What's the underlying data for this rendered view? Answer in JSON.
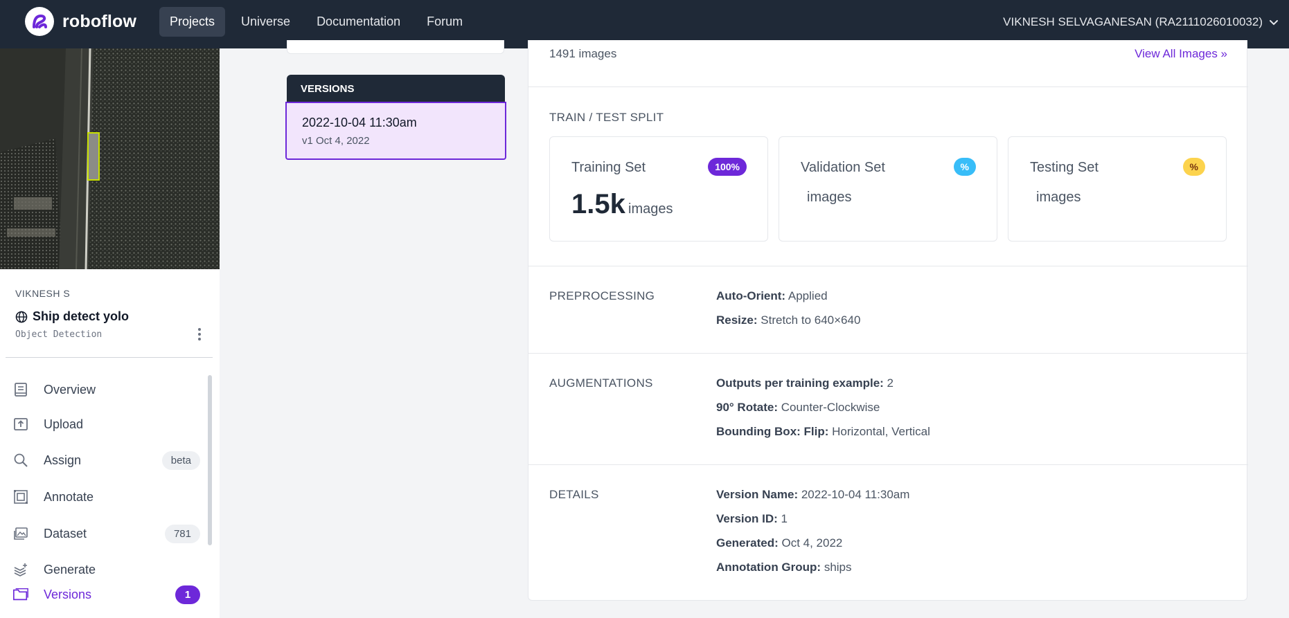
{
  "colors": {
    "nav_bg": "#1f2937",
    "accent": "#6d28d9",
    "selected_bg": "#f2e5fc",
    "validation": "#38bdf8",
    "testing": "#fcd34d"
  },
  "nav": {
    "brand": "roboflow",
    "links": [
      "Projects",
      "Universe",
      "Documentation",
      "Forum"
    ],
    "active_link": "Projects",
    "user": "VIKNESH SELVAGANESAN (RA2111026010032)"
  },
  "project": {
    "owner": "VIKNESH S",
    "name": "Ship detect yolo",
    "type": "Object Detection",
    "visibility_icon": "globe-icon"
  },
  "sidebar": {
    "items": [
      {
        "label": "Overview",
        "icon": "book-icon"
      },
      {
        "label": "Upload",
        "icon": "upload-icon"
      },
      {
        "label": "Assign",
        "icon": "search-icon",
        "badge": "beta"
      },
      {
        "label": "Annotate",
        "icon": "annotate-icon"
      },
      {
        "label": "Dataset",
        "icon": "images-icon",
        "badge": "781"
      },
      {
        "label": "Generate",
        "icon": "layers-plus-icon"
      },
      {
        "label": "Versions",
        "icon": "folder-icon",
        "badge": "1",
        "active": true
      }
    ]
  },
  "versions": {
    "header": "VERSIONS",
    "items": [
      {
        "name": "2022-10-04 11:30am",
        "sub": "v1 Oct 4, 2022",
        "selected": true
      }
    ]
  },
  "main": {
    "image_count": "1491 images",
    "view_all": "View All Images »",
    "split": {
      "title": "TRAIN / TEST SPLIT",
      "cards": [
        {
          "label": "Training Set",
          "pill": "100%",
          "value": "1.5k",
          "unit": "images"
        },
        {
          "label": "Validation Set",
          "pill": "%",
          "value": "",
          "unit": "images"
        },
        {
          "label": "Testing Set",
          "pill": "%",
          "value": "",
          "unit": "images"
        }
      ]
    },
    "preprocessing": {
      "title": "PREPROCESSING",
      "rows": [
        {
          "key": "Auto-Orient:",
          "value": "Applied"
        },
        {
          "key": "Resize:",
          "value": "Stretch to 640×640"
        }
      ]
    },
    "augmentations": {
      "title": "AUGMENTATIONS",
      "rows": [
        {
          "key": "Outputs per training example:",
          "value": "2"
        },
        {
          "key": "90° Rotate:",
          "value": "Counter-Clockwise"
        },
        {
          "key": "Bounding Box: Flip:",
          "value": "Horizontal, Vertical"
        }
      ]
    },
    "details": {
      "title": "DETAILS",
      "rows": [
        {
          "key": "Version Name:",
          "value": "2022-10-04 11:30am"
        },
        {
          "key": "Version ID:",
          "value": "1"
        },
        {
          "key": "Generated:",
          "value": "Oct 4, 2022"
        },
        {
          "key": "Annotation Group:",
          "value": "ships"
        }
      ]
    }
  }
}
